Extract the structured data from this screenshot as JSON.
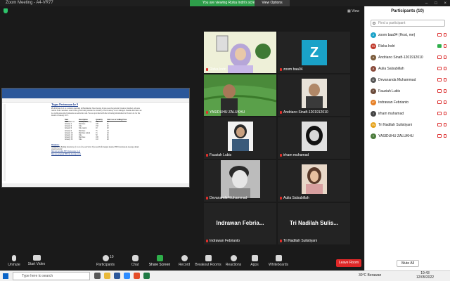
{
  "window": {
    "title": "Zoom Meeting - A4-VR77",
    "banner": "You are viewing Rizka Indri's screen",
    "view_options": "View Options",
    "controls": [
      "–",
      "□",
      "×"
    ]
  },
  "view_label": "View",
  "document": {
    "title": "Tugas Pertemuan ke 9",
    "intro": "PR.09 Potato Ltd. is a retailer operating in Bantimurik, Nusa Serang. Potato uses the periodic inventory method. All sales returns from customers result in the goods being returned to inventory. The inventory is not damaged. Assume that there are no credit sales and all amounts are settled in cash. You are provided with the following information for Potato Ltd. for the month of January 2017.",
    "columns": [
      "Date",
      "Description",
      "Quantity",
      "Unit Cost or Selling Price"
    ],
    "rows": [
      [
        "December 31",
        "Ending inventory",
        "150",
        "19"
      ],
      [
        "January 2",
        "Purchase",
        "100",
        "21"
      ],
      [
        "January 6",
        "Sale",
        "150",
        "40"
      ],
      [
        "January 9",
        "Sale return",
        "10",
        "40"
      ],
      [
        "January 9",
        "Purchase",
        "75",
        "24"
      ],
      [
        "January 10",
        "Purchase return",
        "15",
        "24"
      ],
      [
        "January 10",
        "Sale",
        "50",
        "45"
      ],
      [
        "January 23",
        "Purchase",
        "100",
        "26"
      ],
      [
        "January 30",
        "Sale",
        "110",
        "48"
      ]
    ],
    "section": "Diminta:",
    "instructions": "Hitunglah 1) Ending inventory, 2) Cost of Goods Sold, 3) Gross Profit dengan metode FIFO dan metode Average dalam sistem periodic",
    "links": [
      "Metode periodik FIFO & Average (1-2)",
      "Metode perpetual FIFO & Average (1-2)"
    ]
  },
  "tiles": [
    {
      "name": "Rizka Indri",
      "type": "video"
    },
    {
      "name": "zoom baa04",
      "type": "avatar",
      "initial": "Z"
    },
    {
      "name": "YASIDUHU ZALUKHU",
      "type": "video"
    },
    {
      "name": "Andriano Sinaft-1201912010",
      "type": "video"
    },
    {
      "name": "Fauziah Lubis",
      "type": "video"
    },
    {
      "name": "irham muhamad",
      "type": "video"
    },
    {
      "name": "Devananda Muhammad",
      "type": "video"
    },
    {
      "name": "Aulia Salsabillah",
      "type": "video"
    },
    {
      "name": "Indrawan Febrianto",
      "type": "text",
      "display": "Indrawan Febria..."
    },
    {
      "name": "Tri Nadilah Sulistiyani",
      "type": "text",
      "display": "Tri Nadilah Sulis..."
    }
  ],
  "toolbar": {
    "items": [
      {
        "label": "Unmute",
        "icon": "microphone-icon"
      },
      {
        "label": "Start Video",
        "icon": "video-camera-icon"
      },
      {
        "label": "Participants",
        "icon": "participants-icon",
        "count": "10"
      },
      {
        "label": "Chat",
        "icon": "chat-icon"
      },
      {
        "label": "Share Screen",
        "icon": "share-screen-icon"
      },
      {
        "label": "Record",
        "icon": "record-icon"
      },
      {
        "label": "Breakout Rooms",
        "icon": "breakout-rooms-icon"
      },
      {
        "label": "Reactions",
        "icon": "reactions-icon"
      },
      {
        "label": "Apps",
        "icon": "apps-icon"
      },
      {
        "label": "Whiteboards",
        "icon": "whiteboard-icon"
      }
    ],
    "leave": "Leave Room",
    "share_color": "#2eaf4a"
  },
  "participants": {
    "header": "Participants (10)",
    "search_placeholder": "Find a participant",
    "list": [
      {
        "name": "zoom baa04 (Host, me)",
        "initial": "Z",
        "color": "#1aa2c8"
      },
      {
        "name": "Rizka Indri",
        "initial": "RI",
        "color": "#c0392b"
      },
      {
        "name": "Andriano Sinaft-1201912010",
        "initial": "A",
        "color": "#7a5a3a"
      },
      {
        "name": "Aulia Salsabillah",
        "initial": "A",
        "color": "#8a4a3a"
      },
      {
        "name": "Devananda Muhammad",
        "initial": "D",
        "color": "#555555"
      },
      {
        "name": "Fauziah Lubis",
        "initial": "F",
        "color": "#6a4a3a"
      },
      {
        "name": "Indrawan Febrianto",
        "initial": "IF",
        "color": "#e67e22"
      },
      {
        "name": "irham muhamad",
        "initial": "I",
        "color": "#444444"
      },
      {
        "name": "Tri Nadilah Sulistiyani",
        "initial": "TN",
        "color": "#e6a21a"
      },
      {
        "name": "YASIDUHU ZALUKHU",
        "initial": "Y",
        "color": "#4a7a3a"
      }
    ],
    "mute_all": "Mute All"
  },
  "taskbar": {
    "search": "Type here to search",
    "weather": "30°C Berawan",
    "time": "19:43",
    "date": "12/05/2022"
  }
}
